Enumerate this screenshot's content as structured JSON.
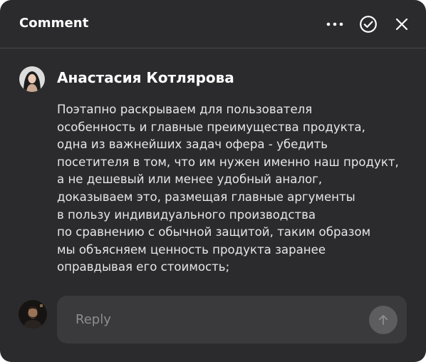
{
  "header": {
    "title": "Comment",
    "icons": {
      "more": "more-horizontal-icon",
      "resolve": "check-circle-icon",
      "close": "close-icon"
    }
  },
  "comment": {
    "author": "Анастасия Котлярова",
    "lines": [
      "Поэтапно раскрываем для пользователя",
      "особенность и главные преимущества продукта,",
      "одна из важнейших задач офера - убедить",
      "посетителя в том, что им нужен именно наш продукт,",
      "а не дешевый или менее удобный аналог,",
      "доказываем это, размещая главные аргументы",
      "в пользу индивидуального производства",
      "по сравнению с обычной защитой, таким образом",
      "мы объясняем ценность продукта заранее",
      "оправдывая его стоимость;"
    ]
  },
  "reply": {
    "placeholder": "Reply",
    "value": "",
    "send_icon": "arrow-up-icon"
  },
  "colors": {
    "panel_bg": "#2b2b2d",
    "reply_bg": "#3a3a3d",
    "send_bg": "#5d5d60",
    "text": "#ffffff",
    "placeholder": "#8e8e92"
  }
}
